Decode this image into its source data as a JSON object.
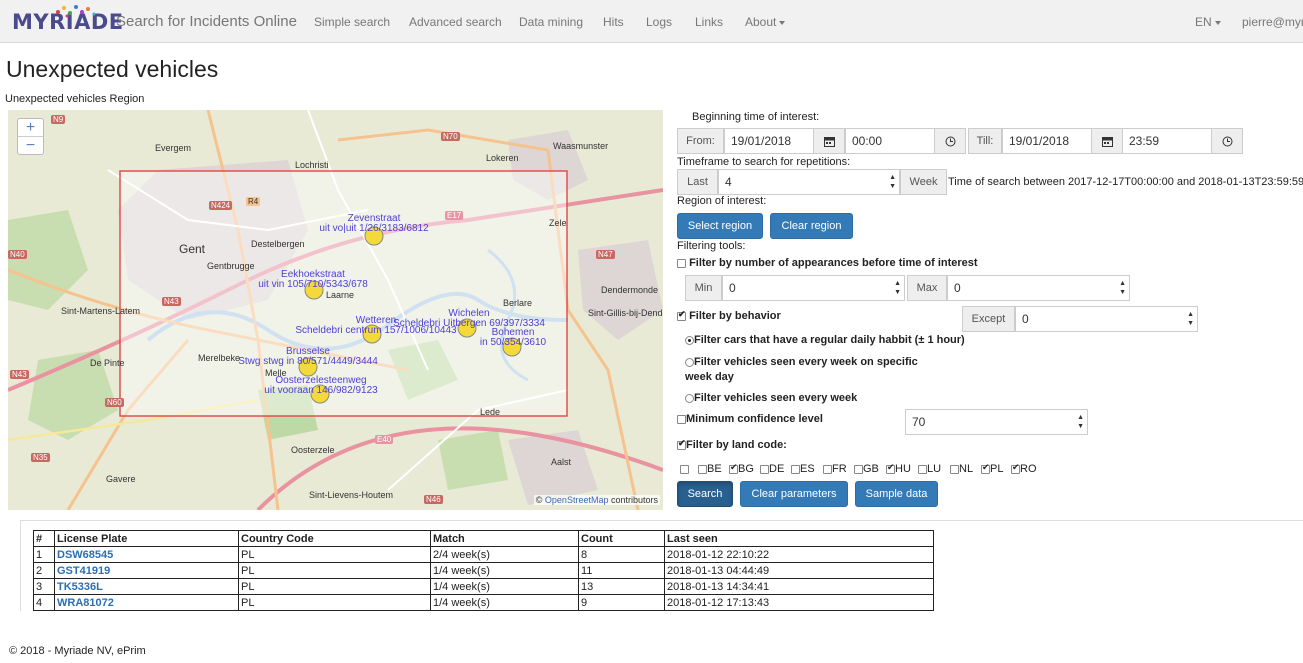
{
  "brand": {
    "logo": "MYRIADE",
    "title": "Search for Incidents Online"
  },
  "nav": {
    "items": [
      "Simple search",
      "Advanced search",
      "Data mining",
      "Hits",
      "Logs",
      "Links",
      "About"
    ],
    "lang": "EN",
    "user": "pierre@myriade"
  },
  "page": {
    "title": "Unexpected vehicles",
    "region_caption": "Unexpected vehicles Region"
  },
  "map": {
    "zoom_in": "+",
    "zoom_out": "−",
    "attribution_prefix": "© ",
    "attribution_link": "OpenStreetMap",
    "attribution_suffix": " contributors",
    "places": [
      "Evergem",
      "Lochristi",
      "Lokeren",
      "Waasmunster",
      "Gent",
      "Destelbergen",
      "Gentbrugge",
      "Laarne",
      "Zele",
      "Dendermonde",
      "Sint-Martens-Latem",
      "Berlare",
      "Sint-Gillis-bij-Dende",
      "De Pinte",
      "Merelbeke",
      "Melle",
      "Lede",
      "Oosterzele",
      "Aalst",
      "Gavere",
      "Sint-Lievens-Houtem"
    ],
    "roads": [
      "N9",
      "N70",
      "N424",
      "R4",
      "E17",
      "N43",
      "N47",
      "N60",
      "N35",
      "E40",
      "N46",
      "N40",
      "N43"
    ],
    "markers": [
      {
        "name": "Zevenstraat",
        "detail": "uit vo|uit 1/26/3183/6812"
      },
      {
        "name": "Eekhoekstraat",
        "detail": "uit vin 105/710/5343/678"
      },
      {
        "name": "Wetteren",
        "detail": "Scheldebri centrum 157/1006/10443"
      },
      {
        "name": "Wichelen",
        "detail": "Scheldebri Uitbergen 69/397/3334"
      },
      {
        "name": "Bohemen",
        "detail": "in 50/354/3610"
      },
      {
        "name": "Brusselse",
        "detail": "Stwg stwg in 80/571/4449/3444"
      },
      {
        "name": "Oosterzelesteenweg",
        "detail": "uit vooraan 146/982/9123"
      }
    ]
  },
  "form": {
    "beginning_label": "Beginning time of interest:",
    "from_label": "From:",
    "from_date": "19/01/2018",
    "from_time": "00:00",
    "till_label": "Till:",
    "till_date": "19/01/2018",
    "till_time": "23:59",
    "timeframe_label": "Timeframe to search for repetitions:",
    "last_label": "Last",
    "last_value": "4",
    "week_label": "Week",
    "time_of_search": "Time of search between 2017-12-17T00:00:00 and 2018-01-13T23:59:59",
    "region_label": "Region of interest:",
    "select_region": "Select region",
    "clear_region": "Clear region",
    "filtering_label": "Filtering tools:",
    "filter_appearances": "Filter by number of appearances before time of interest",
    "min_label": "Min",
    "min_value": "0",
    "max_label": "Max",
    "max_value": "0",
    "filter_behavior": "Filter by behavior",
    "except_label": "Except",
    "except_value": "0",
    "radio_daily": "Filter cars that have a regular daily habbit (± 1 hour)",
    "radio_weekly_specific": "Filter vehicles seen every week on specific week day",
    "radio_weekly": "Filter vehicles seen every week",
    "min_confidence": "Minimum confidence level",
    "confidence_value": "70",
    "filter_land": "Filter by land code:",
    "land_codes": [
      {
        "code": "",
        "checked": false
      },
      {
        "code": "BE",
        "checked": false
      },
      {
        "code": "BG",
        "checked": true
      },
      {
        "code": "DE",
        "checked": false
      },
      {
        "code": "ES",
        "checked": false
      },
      {
        "code": "FR",
        "checked": false
      },
      {
        "code": "GB",
        "checked": false
      },
      {
        "code": "HU",
        "checked": true
      },
      {
        "code": "LU",
        "checked": false
      },
      {
        "code": "NL",
        "checked": false
      },
      {
        "code": "PL",
        "checked": true
      },
      {
        "code": "RO",
        "checked": true
      }
    ],
    "search_button": "Search",
    "clear_parameters": "Clear parameters",
    "sample_data": "Sample data"
  },
  "results": {
    "headers": [
      "#",
      "License Plate",
      "Country Code",
      "Match",
      "Count",
      "Last seen"
    ],
    "rows": [
      {
        "num": "1",
        "plate": "DSW68545",
        "country": "PL",
        "match": "2/4 week(s)",
        "count": "8",
        "last_seen": "2018-01-12 22:10:22"
      },
      {
        "num": "2",
        "plate": "GST41919",
        "country": "PL",
        "match": "1/4 week(s)",
        "count": "11",
        "last_seen": "2018-01-13 04:44:49"
      },
      {
        "num": "3",
        "plate": "TK5336L",
        "country": "PL",
        "match": "1/4 week(s)",
        "count": "13",
        "last_seen": "2018-01-13 14:34:41"
      },
      {
        "num": "4",
        "plate": "WRA81072",
        "country": "PL",
        "match": "1/4 week(s)",
        "count": "9",
        "last_seen": "2018-01-12 17:13:43"
      }
    ]
  },
  "footer": "© 2018 - Myriade NV, ePrim",
  "colors": {
    "primary": "#337ab7",
    "region_rect": "#e05050",
    "marker_label": "#4d3fd6",
    "marker": "#f3d93a"
  }
}
